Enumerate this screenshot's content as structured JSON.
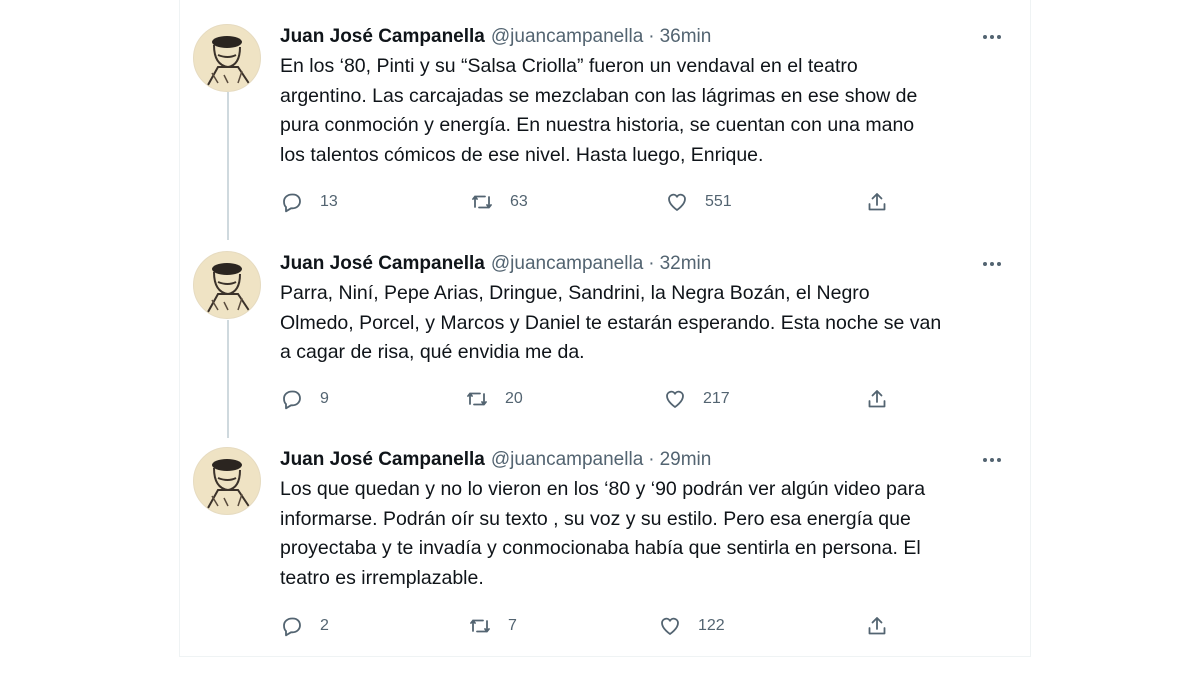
{
  "tweets": [
    {
      "name": "Juan José Campanella",
      "handle": "@juancampanella",
      "separator": "·",
      "time": "36min",
      "lines": [
        "En los ‘80, Pinti y su “Salsa Criolla” fueron un vendaval en el teatro",
        "argentino. Las carcajadas se mezclaban con las lágrimas en ese show de",
        "pura conmoción y energía. En nuestra historia, se cuentan con una mano",
        "los talentos cómicos de ese nivel. Hasta luego, Enrique."
      ],
      "replies": "13",
      "retweets": "63",
      "likes": "551"
    },
    {
      "name": "Juan José Campanella",
      "handle": "@juancampanella",
      "separator": "·",
      "time": "32min",
      "lines": [
        "Parra, Niní, Pepe Arias, Dringue, Sandrini, la Negra Bozán, el Negro",
        "Olmedo, Porcel, y Marcos y Daniel te estarán esperando. Esta noche se van",
        "a cagar de risa, qué envidia me da."
      ],
      "replies": "9",
      "retweets": "20",
      "likes": "217"
    },
    {
      "name": "Juan José Campanella",
      "handle": "@juancampanella",
      "separator": "·",
      "time": "29min",
      "lines": [
        "Los que quedan y no lo vieron en los ‘80 y ‘90 podrán ver algún video para",
        "informarse. Podrán oír su texto , su voz y su estilo. Pero esa energía que",
        "proyectaba y te invadía y conmocionaba había que sentirla en persona. El",
        "teatro es irremplazable."
      ],
      "replies": "2",
      "retweets": "7",
      "likes": "122"
    }
  ],
  "icons": {
    "reply": "reply-icon",
    "retweet": "retweet-icon",
    "like": "heart-icon",
    "share": "share-icon",
    "more": "more-icon"
  },
  "colors": {
    "text": "#0f1419",
    "secondary": "#536471",
    "thread_line": "#cfd9de",
    "border": "#eff3f4"
  }
}
